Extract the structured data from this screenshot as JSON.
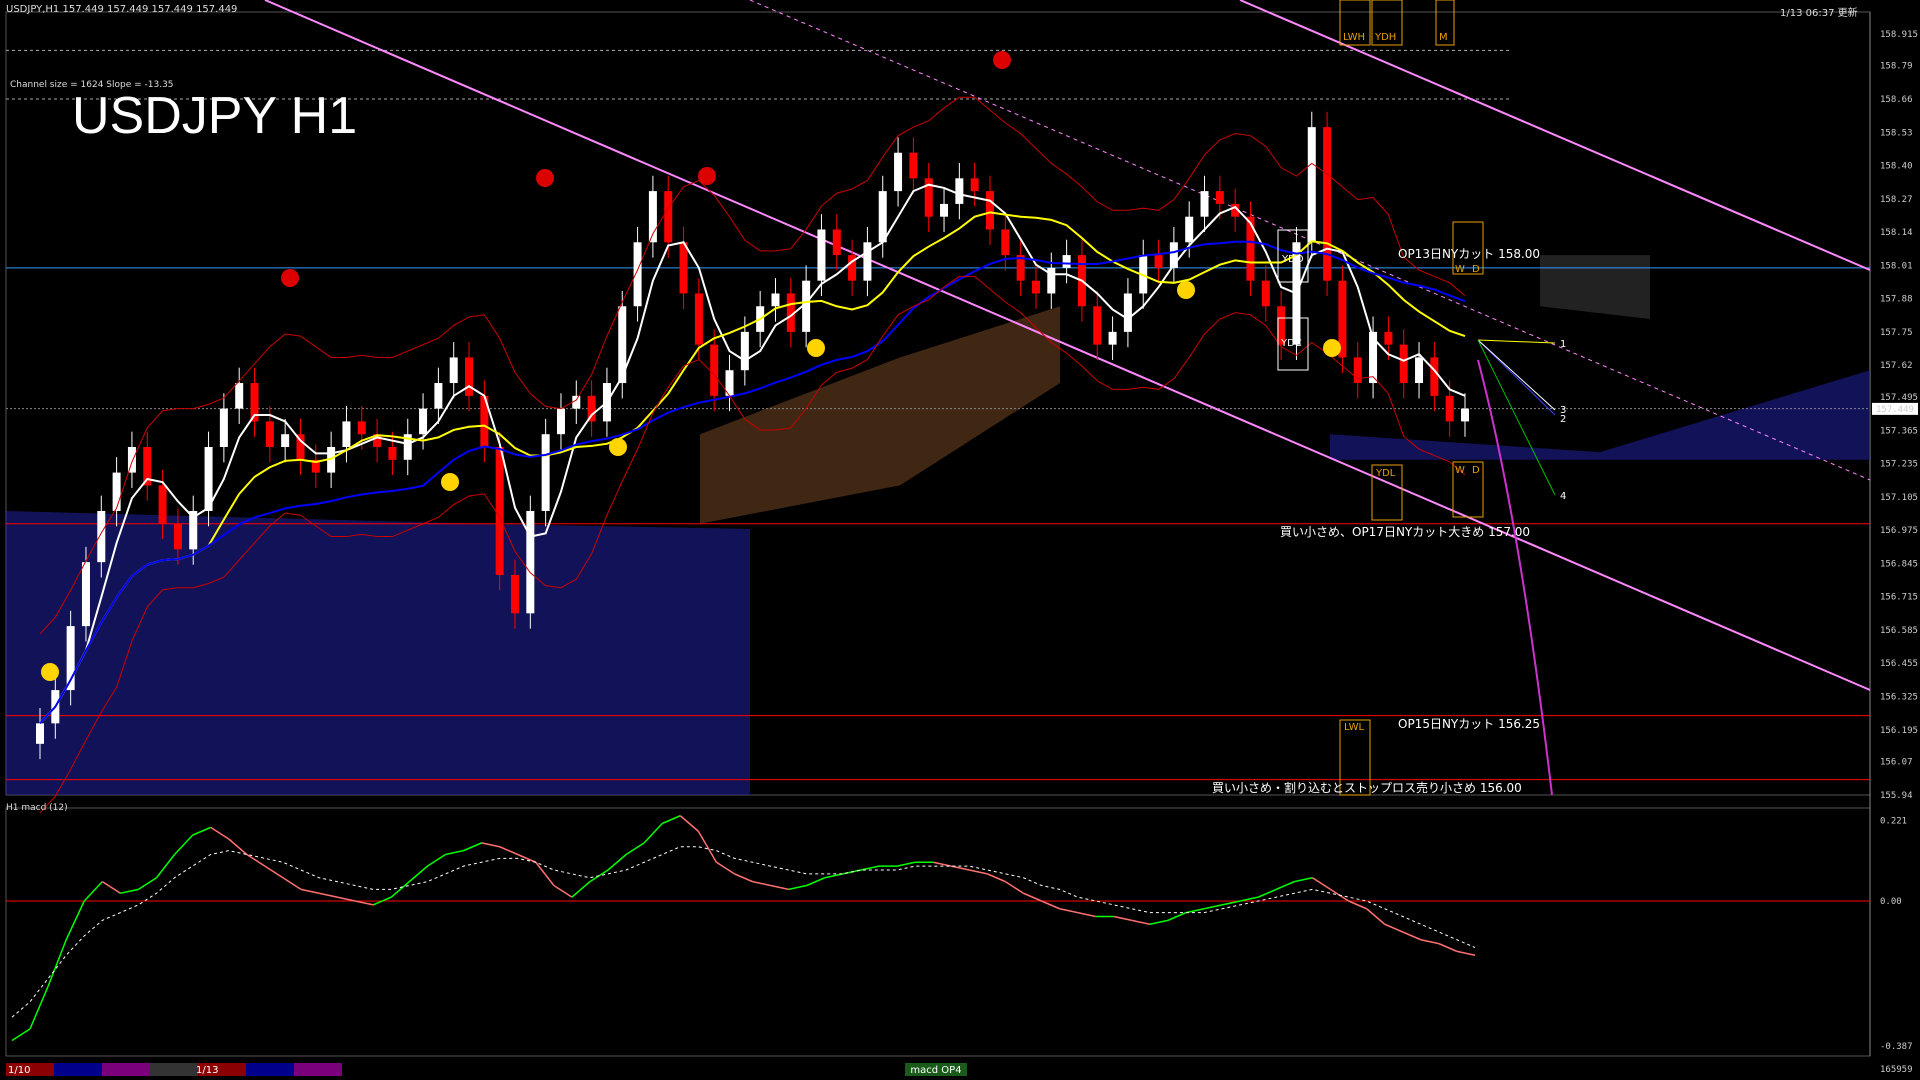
{
  "header": {
    "symbol_info": "USDJPY,H1  157.449 157.449 157.449 157.449",
    "channel_info": "Channel size = 1624 Slope = -13.35",
    "timestamp": "1/13 06:37 更新",
    "title": "USDJPY H1"
  },
  "macd_panel": {
    "label": "H1  macd (12)",
    "scale": [
      "0.221",
      "0.00",
      "-0.387"
    ],
    "bottom_value": "165959"
  },
  "bottom_bar": {
    "dates": [
      "1/10",
      "1/13"
    ],
    "tab_label": "macd OP4",
    "colors": [
      "#8b0000",
      "#00008b",
      "#7b007b",
      "#333333",
      "#8b0000",
      "#00008b",
      "#7b007b"
    ]
  },
  "annotations": {
    "op13": "OP13日NYカット 158.00",
    "op17": "買い小さめ、OP17日NYカット大きめ 157.00",
    "op15": "OP15日NYカット 156.25",
    "stop": "買い小さめ・割り込むとストップロス売り小さめ 156.00",
    "ydo": "YDO",
    "ydc": "YDC",
    "lwh": "LWH",
    "ydh": "YDH",
    "m": "M",
    "ydl": "YDL",
    "lwl": "LWL",
    "w": "W",
    "d": "D",
    "fan": [
      "1",
      "2",
      "3",
      "4"
    ]
  },
  "colors": {
    "bullish_candle": "#ffffff",
    "bearish_candle": "#ff0000",
    "sma_fast": "#ffffff",
    "sma_mid": "#ffff00",
    "sma_slow": "#0000ff",
    "channel": "#ff88ff",
    "cloud_blue": "#2020a0",
    "cloud_orange": "#d08040",
    "macd_up": "#00ff00",
    "macd_down": "#ff7070",
    "signal": "#ffffff",
    "resistance": "#ff0000"
  },
  "chart_data": {
    "type": "candlestick",
    "symbol": "USDJPY",
    "timeframe": "H1",
    "ylim": [
      155.94,
      159.0
    ],
    "y_ticks": [
      158.915,
      158.79,
      158.66,
      158.53,
      158.4,
      158.27,
      158.14,
      158.01,
      157.88,
      157.75,
      157.62,
      157.495,
      157.365,
      157.235,
      157.105,
      156.975,
      156.845,
      156.715,
      156.585,
      156.455,
      156.325,
      156.195,
      156.07,
      155.94
    ],
    "current_price": "157.449",
    "levels": [
      {
        "price": 158.0,
        "color": "#3399ff"
      },
      {
        "price": 157.0,
        "color": "#ff0000"
      },
      {
        "price": 156.25,
        "color": "#ff0000"
      },
      {
        "price": 156.0,
        "color": "#ff0000"
      },
      {
        "price": 157.45,
        "color": "#888888"
      }
    ],
    "closes": [
      156.22,
      156.35,
      156.6,
      156.85,
      157.05,
      157.2,
      157.3,
      157.15,
      157.0,
      156.9,
      157.05,
      157.3,
      157.45,
      157.55,
      157.4,
      157.3,
      157.35,
      157.25,
      157.2,
      157.3,
      157.4,
      157.35,
      157.3,
      157.25,
      157.35,
      157.45,
      157.55,
      157.65,
      157.5,
      157.3,
      156.8,
      156.65,
      157.05,
      157.35,
      157.45,
      157.5,
      157.4,
      157.55,
      157.85,
      158.1,
      158.3,
      158.1,
      157.9,
      157.7,
      157.5,
      157.6,
      157.75,
      157.85,
      157.9,
      157.75,
      157.95,
      158.15,
      158.05,
      157.95,
      158.1,
      158.3,
      158.45,
      158.35,
      158.2,
      158.25,
      158.35,
      158.3,
      158.15,
      158.05,
      157.95,
      157.9,
      158.0,
      158.05,
      157.85,
      157.7,
      157.75,
      157.9,
      158.05,
      158.0,
      158.1,
      158.2,
      158.3,
      158.25,
      158.2,
      157.95,
      157.85,
      157.7,
      158.1,
      158.55,
      157.95,
      157.65,
      157.55,
      157.75,
      157.7,
      157.55,
      157.65,
      157.5,
      157.4,
      157.45
    ],
    "macd": [
      -0.36,
      -0.33,
      -0.22,
      -0.1,
      0.0,
      0.05,
      0.02,
      0.03,
      0.06,
      0.12,
      0.17,
      0.19,
      0.16,
      0.12,
      0.09,
      0.06,
      0.03,
      0.02,
      0.01,
      0.0,
      -0.01,
      0.01,
      0.05,
      0.09,
      0.12,
      0.13,
      0.15,
      0.14,
      0.12,
      0.1,
      0.04,
      0.01,
      0.05,
      0.08,
      0.12,
      0.15,
      0.2,
      0.22,
      0.18,
      0.1,
      0.07,
      0.05,
      0.04,
      0.03,
      0.04,
      0.06,
      0.07,
      0.08,
      0.09,
      0.09,
      0.1,
      0.1,
      0.09,
      0.08,
      0.07,
      0.05,
      0.02,
      0.0,
      -0.02,
      -0.03,
      -0.04,
      -0.04,
      -0.05,
      -0.06,
      -0.05,
      -0.03,
      -0.02,
      -0.01,
      0.0,
      0.01,
      0.03,
      0.05,
      0.06,
      0.03,
      0.0,
      -0.02,
      -0.06,
      -0.08,
      -0.1,
      -0.11,
      -0.13,
      -0.14
    ],
    "signal": [
      -0.3,
      -0.26,
      -0.2,
      -0.14,
      -0.09,
      -0.05,
      -0.03,
      -0.01,
      0.02,
      0.06,
      0.09,
      0.12,
      0.13,
      0.12,
      0.11,
      0.1,
      0.08,
      0.06,
      0.05,
      0.04,
      0.03,
      0.03,
      0.04,
      0.05,
      0.07,
      0.09,
      0.1,
      0.11,
      0.11,
      0.1,
      0.08,
      0.07,
      0.06,
      0.07,
      0.08,
      0.1,
      0.12,
      0.14,
      0.14,
      0.13,
      0.11,
      0.1,
      0.09,
      0.08,
      0.07,
      0.07,
      0.07,
      0.08,
      0.08,
      0.08,
      0.09,
      0.09,
      0.09,
      0.09,
      0.08,
      0.07,
      0.06,
      0.04,
      0.03,
      0.01,
      0.0,
      -0.01,
      -0.02,
      -0.03,
      -0.03,
      -0.03,
      -0.03,
      -0.02,
      -0.01,
      0.0,
      0.01,
      0.02,
      0.03,
      0.02,
      0.01,
      0.0,
      -0.02,
      -0.04,
      -0.06,
      -0.08,
      -0.1,
      -0.12
    ]
  }
}
